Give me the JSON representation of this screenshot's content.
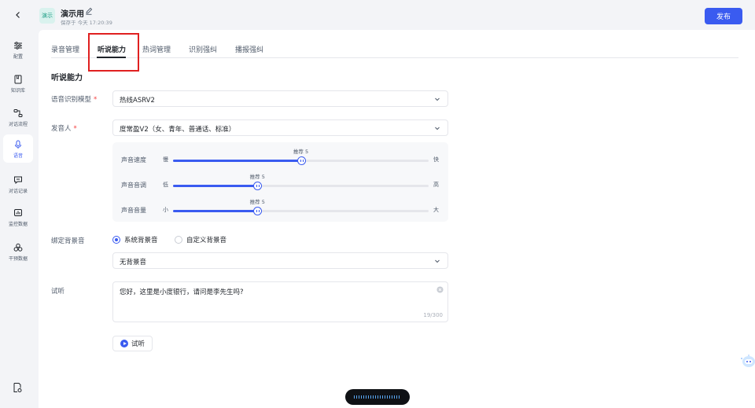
{
  "sidebar": {
    "items": [
      {
        "label": "配置",
        "icon": "sliders-icon"
      },
      {
        "label": "知识库",
        "icon": "book-icon"
      },
      {
        "label": "对话流程",
        "icon": "flow-icon"
      },
      {
        "label": "语音",
        "icon": "microphone-icon",
        "active": true
      },
      {
        "label": "对话记录",
        "icon": "chat-record-icon"
      },
      {
        "label": "监控数据",
        "icon": "monitor-icon"
      },
      {
        "label": "干预数据",
        "icon": "intervene-icon"
      }
    ]
  },
  "header": {
    "badge": "演示",
    "title": "演示用",
    "save_info": "保存于 今天 17:20:39",
    "publish_label": "发布"
  },
  "tabs": [
    "录音管理",
    "听说能力",
    "热词管理",
    "识别强纠",
    "播报强纠"
  ],
  "active_tab": 1,
  "section_title": "听说能力",
  "form": {
    "asr_model": {
      "label": "语音识别模型",
      "value": "热线ASRV2"
    },
    "speaker": {
      "label": "发音人",
      "value": "度常盈V2（女、青年、普通话、标准）"
    },
    "sliders": [
      {
        "name": "声音速度",
        "min_label": "慢",
        "max_label": "快",
        "recommend": "推荐 5",
        "level": 0.5
      },
      {
        "name": "声音音调",
        "min_label": "低",
        "max_label": "高",
        "recommend": "推荐 5",
        "level": 0.33
      },
      {
        "name": "声音音量",
        "min_label": "小",
        "max_label": "大",
        "recommend": "推荐 5",
        "level": 0.33
      }
    ],
    "bg_sound": {
      "label": "绑定背景音",
      "options": [
        "系统背景音",
        "自定义背景音"
      ],
      "selected": 0,
      "value": "无背景音"
    },
    "preview": {
      "label": "试听",
      "text": "您好，这里是小度银行，请问是李先生吗?",
      "count": "19/300",
      "button": "试听"
    }
  },
  "colors": {
    "accent": "#3a5bf0",
    "highlight": "#e02020"
  }
}
